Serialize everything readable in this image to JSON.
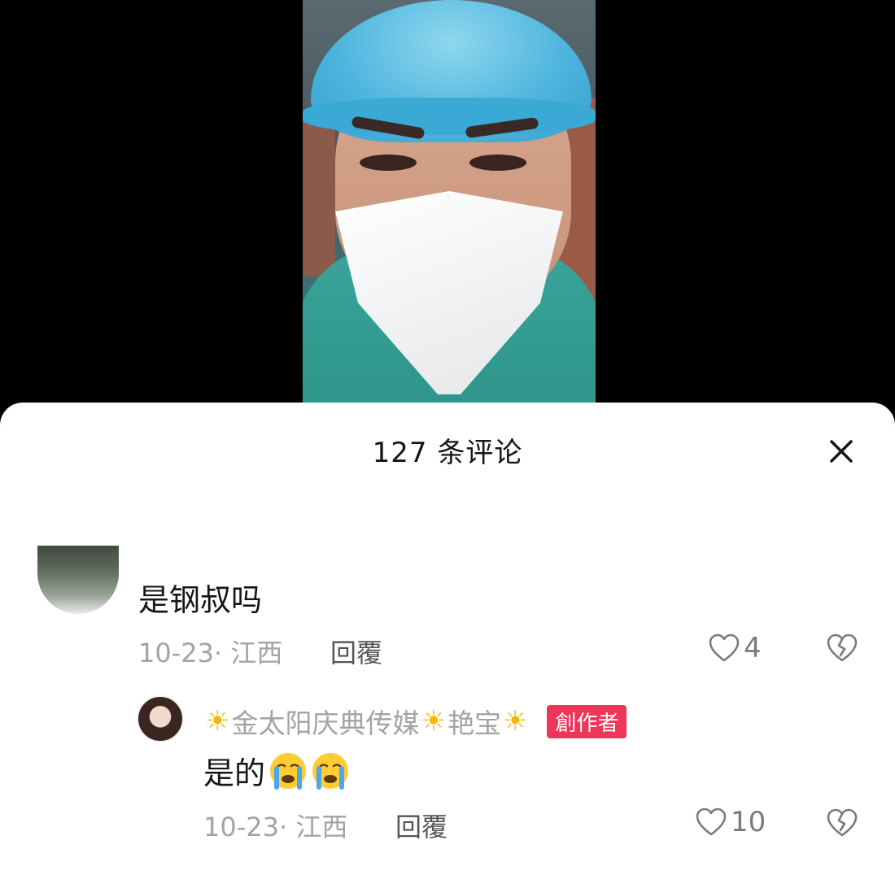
{
  "sheet": {
    "title": "127 条评论"
  },
  "comments": [
    {
      "text": "是钢叔吗",
      "meta": "10-23· 江西",
      "reply_label": "回覆",
      "likes": "4"
    }
  ],
  "reply": {
    "author": [
      "金太阳庆典传媒",
      "艳宝"
    ],
    "author_badge": "創作者",
    "text": "是的",
    "emoji": [
      "loudly-crying-face",
      "loudly-crying-face"
    ],
    "meta": "10-23· 江西",
    "reply_label": "回覆",
    "likes": "10"
  },
  "colors": {
    "badge": "#f0355a",
    "sun": "#f5b800",
    "meta_text": "#a3a3a3"
  }
}
